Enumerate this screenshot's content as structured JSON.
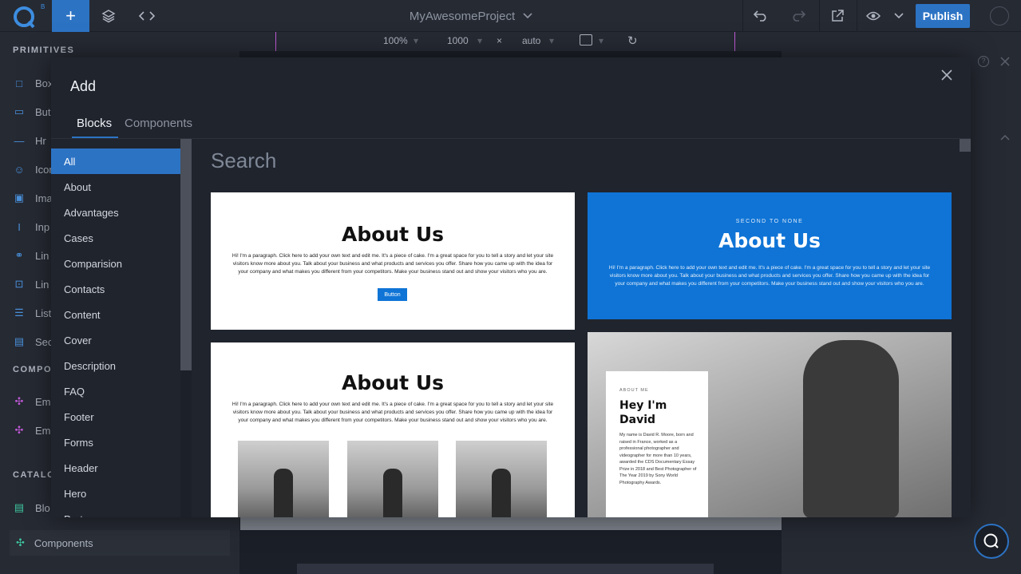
{
  "topbar": {
    "logo_letter": "Q",
    "logo_badge": "B",
    "project_name": "MyAwesomeProject",
    "publish_label": "Publish"
  },
  "canvas_bar": {
    "zoom": "100%",
    "width": "1000",
    "times": "×",
    "height": "auto"
  },
  "sidebar": {
    "primitives_heading": "PRIMITIVES",
    "primitives": [
      "Box",
      "But",
      "Hr",
      "Icon",
      "Ima",
      "Inp",
      "Lin",
      "Lin",
      "List",
      "Sec"
    ],
    "components_heading": "COMPO",
    "components": [
      "Em",
      "Em"
    ],
    "catalog_heading": "CATALO",
    "catalog": [
      "Blo"
    ],
    "components_item": "Components"
  },
  "modal": {
    "title": "Add",
    "close_icon": "close-icon",
    "tabs": [
      {
        "label": "Blocks",
        "active": true
      },
      {
        "label": "Components",
        "active": false
      }
    ],
    "categories": [
      "All",
      "About",
      "Advantages",
      "Cases",
      "Comparision",
      "Contacts",
      "Content",
      "Cover",
      "Description",
      "FAQ",
      "Footer",
      "Forms",
      "Header",
      "Hero",
      "Partners"
    ],
    "active_category": "All",
    "search_placeholder": "Search",
    "cards": {
      "card1": {
        "title": "About Us",
        "body": "Hi! I'm a paragraph. Click here to add your own text and edit me. It's a piece of cake. I'm a great space for you to tell a story and let your site visitors know more about you. Talk about your business and what products and services you offer. Share how you came up with the idea for your company and what makes you different from your competitors. Make your business stand out and show your visitors who you are.",
        "button": "Button"
      },
      "card2": {
        "kicker": "SECOND TO NONE",
        "title": "About Us",
        "body": "Hi! I'm a paragraph. Click here to add your own text and edit me. It's a piece of cake. I'm a great space for you to tell a story and let your site visitors know more about you. Talk about your business and what products and services you offer. Share how you came up with the idea for your company and what makes you different from your competitors. Make your business stand out and show your visitors who you are."
      },
      "card3": {
        "title": "About Us",
        "body": "Hi! I'm a paragraph. Click here to add your own text and edit me. It's a piece of cake. I'm a great space for you to tell a story and let your site visitors know more about you. Talk about your business and what products and services you offer. Share how you came up with the idea for your company and what makes you different from your competitors. Make your business stand out and show your visitors who you are."
      },
      "card4": {
        "kicker": "ABOUT ME",
        "title": "Hey I'm David",
        "body": "My name is David R. Moore, born and raised in France, worked as a professional photographer and videographer for more than 10 years, awarded the CDS Documentary Essay Prize in 2018 and Best Photographer of The Year 2019 by Sony World Photography Awards."
      }
    }
  },
  "colors": {
    "accent": "#2c73c4",
    "card_blue": "#0f74d6"
  }
}
